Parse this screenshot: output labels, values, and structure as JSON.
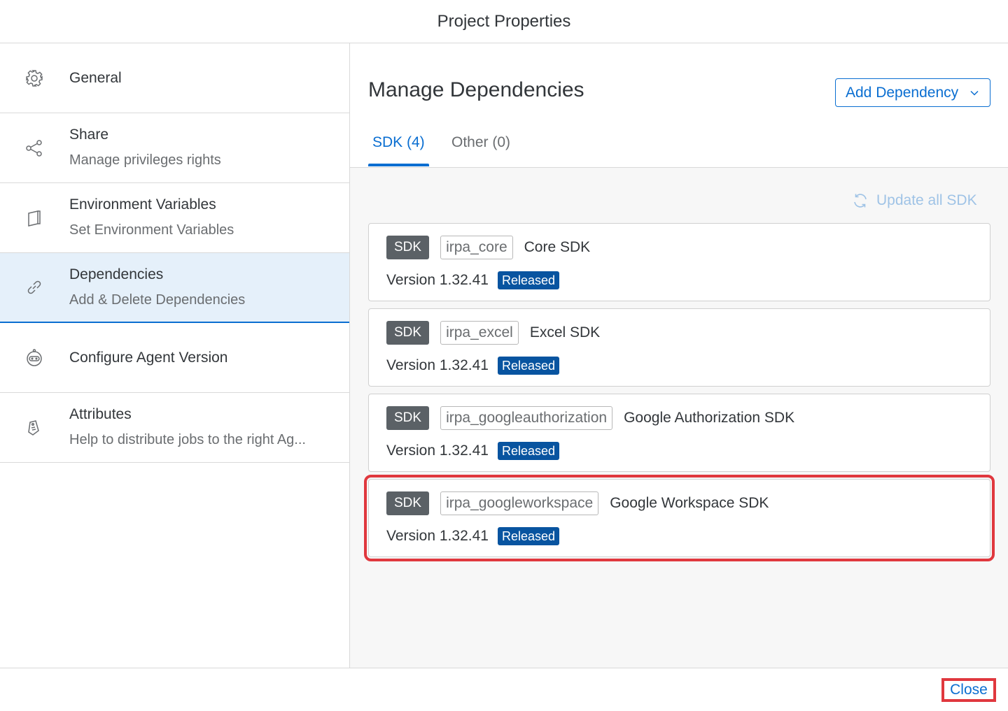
{
  "dialog": {
    "title": "Project Properties"
  },
  "sidebar": {
    "items": [
      {
        "label": "General",
        "sub": "",
        "icon": "gear-icon"
      },
      {
        "label": "Share",
        "sub": "Manage privileges rights",
        "icon": "share-icon"
      },
      {
        "label": "Environment Variables",
        "sub": "Set Environment Variables",
        "icon": "document-icon"
      },
      {
        "label": "Dependencies",
        "sub": "Add & Delete Dependencies",
        "icon": "chain-link-icon",
        "selected": true
      },
      {
        "label": "Configure Agent Version",
        "sub": "",
        "icon": "robot-icon"
      },
      {
        "label": "Attributes",
        "sub": "Help to distribute jobs to the right Ag...",
        "icon": "tag-icon"
      }
    ]
  },
  "main": {
    "title": "Manage Dependencies",
    "add_dependency_label": "Add Dependency",
    "tabs": [
      {
        "label": "SDK (4)",
        "active": true
      },
      {
        "label": "Other (0)",
        "active": false
      }
    ],
    "update_all_label": "Update all SDK",
    "sdks": [
      {
        "badge": "SDK",
        "id": "irpa_core",
        "name": "Core SDK",
        "version": "Version 1.32.41",
        "status": "Released"
      },
      {
        "badge": "SDK",
        "id": "irpa_excel",
        "name": "Excel SDK",
        "version": "Version 1.32.41",
        "status": "Released"
      },
      {
        "badge": "SDK",
        "id": "irpa_googleauthorization",
        "name": "Google Authorization SDK",
        "version": "Version 1.32.41",
        "status": "Released"
      },
      {
        "badge": "SDK",
        "id": "irpa_googleworkspace",
        "name": "Google Workspace SDK",
        "version": "Version 1.32.41",
        "status": "Released",
        "highlighted": true
      }
    ]
  },
  "footer": {
    "close_label": "Close"
  },
  "colors": {
    "accent": "#0a6ed1",
    "highlight": "#e0383e",
    "released": "#0854a0",
    "sdk_badge": "#5b6166"
  }
}
